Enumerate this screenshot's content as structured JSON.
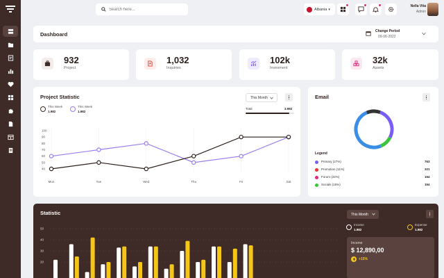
{
  "topbar": {
    "search_placeholder": "Search here...",
    "language": "Albania",
    "user_name": "Nella Vita",
    "user_role": "Admin"
  },
  "dashboard": {
    "title": "Dashboard",
    "period_label": "Change Period",
    "period_date": "09-06-2022"
  },
  "stats": [
    {
      "value": "932",
      "label": "Project",
      "icon": "briefcase-icon",
      "color": "#3e2a26"
    },
    {
      "value": "1,032",
      "label": "Inquiries",
      "icon": "document-icon",
      "color": "#e5362c"
    },
    {
      "value": "102k",
      "label": "Invesment",
      "icon": "chart-icon",
      "color": "#7b5cf5"
    },
    {
      "value": "32k",
      "label": "Assets",
      "icon": "boxes-icon",
      "color": "#e0287c"
    }
  ],
  "project_statistic": {
    "title": "Project Statistic",
    "dropdown": "This Month",
    "legend": [
      {
        "label": "This Week",
        "value": "1.982",
        "color": "#3e2a26"
      },
      {
        "label": "This Week",
        "value": "1.982",
        "color": "#9b7cf0"
      }
    ],
    "total_label": "Total",
    "total_value": "3.982",
    "total_progress": 0.9
  },
  "chart_data": {
    "type": "line",
    "categories": [
      "Mon",
      "Tue",
      "Wed",
      "Thu",
      "Fri",
      "Sat"
    ],
    "ylim": [
      40,
      100
    ],
    "yticks": [
      100,
      90,
      80,
      70,
      60,
      50,
      40
    ],
    "series": [
      {
        "color": "#9b7cf0",
        "values": [
          60,
          70,
          80,
          50,
          60,
          90
        ]
      },
      {
        "color": "#2b1f1c",
        "values": [
          40,
          50,
          40,
          60,
          90,
          90
        ]
      }
    ]
  },
  "email": {
    "title": "Email",
    "legend_title": "Legend",
    "donut": [
      {
        "value": 27,
        "color": "#7b5cf5"
      },
      {
        "value": 11,
        "color": "#3bc53b"
      },
      {
        "value": 50,
        "color": "#3a8ee6"
      },
      {
        "value": 12,
        "color": "#333333"
      }
    ],
    "items": [
      {
        "label": "Primary (27%)",
        "value": "763",
        "color": "#7b5cf5"
      },
      {
        "label": "Promotion (11%)",
        "value": "321",
        "color": "#e5362c"
      },
      {
        "label": "Forum (22%)",
        "value": "154",
        "color": "#e0287c"
      },
      {
        "label": "Socials (15%)",
        "value": "154",
        "color": "#3bc53b"
      }
    ]
  },
  "statistic": {
    "title": "Statistic",
    "dropdown": "This Month",
    "income_label": "Income",
    "income_value": "1.982",
    "expense_label": "Expense",
    "expense_value": "1.982",
    "box_label": "Income",
    "box_value": "$ 12,890,00",
    "box_change": "+15%",
    "yticks": [
      50,
      40,
      30,
      20
    ],
    "bars": [
      {
        "white": 22,
        "yellow": 0
      },
      {
        "white": 36,
        "yellow": 25
      },
      {
        "white": 11,
        "yellow": 42
      },
      {
        "white": 18,
        "yellow": 20
      },
      {
        "white": 33,
        "yellow": 34
      },
      {
        "white": 16,
        "yellow": 20
      },
      {
        "white": 34,
        "yellow": 34
      },
      {
        "white": 14,
        "yellow": 18
      },
      {
        "white": 30,
        "yellow": 39
      },
      {
        "white": 20,
        "yellow": 22
      },
      {
        "white": 34,
        "yellow": 34
      },
      {
        "white": 20,
        "yellow": 32
      },
      {
        "white": 36,
        "yellow": 35
      }
    ]
  }
}
